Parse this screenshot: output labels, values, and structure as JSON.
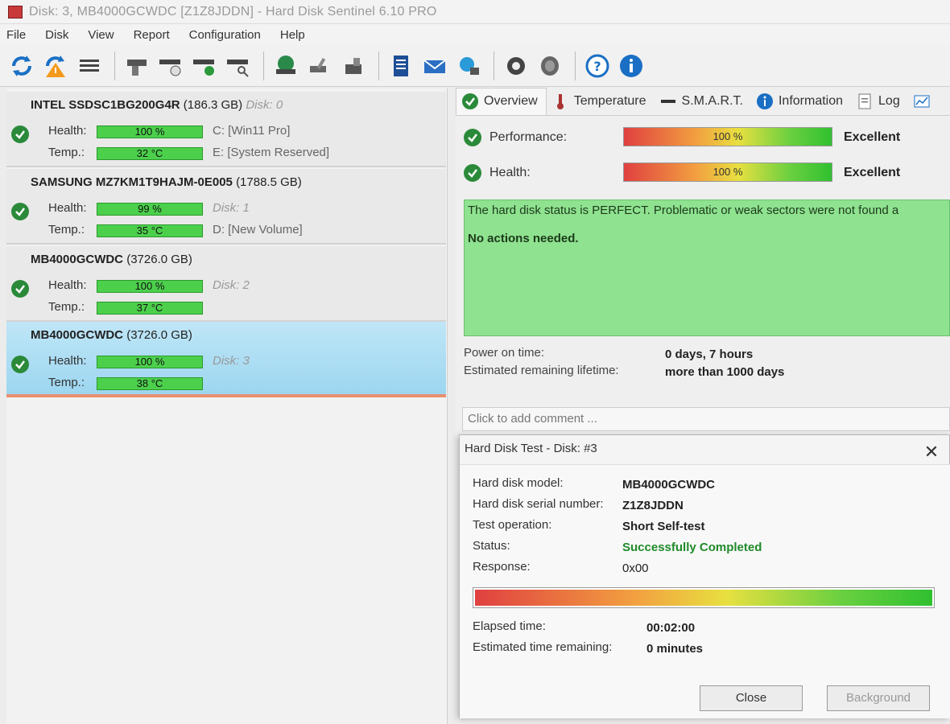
{
  "window": {
    "title": "Disk: 3, MB4000GCWDC [Z1Z8JDDN]  -  Hard Disk Sentinel 6.10 PRO"
  },
  "menu": [
    "File",
    "Disk",
    "View",
    "Report",
    "Configuration",
    "Help"
  ],
  "toolbar_icons": [
    "refresh-icon",
    "alert-refresh-icon",
    "disk-list-icon",
    "disk-info-icon",
    "disk-schedule-icon",
    "disk-check-icon",
    "disk-search-icon",
    "globe-disk-icon",
    "disk-tools-icon",
    "disk-lock-icon",
    "report-icon",
    "mail-icon",
    "network-icon",
    "settings-icon",
    "speaker-icon",
    "help-icon",
    "info-icon"
  ],
  "disks": [
    {
      "name": "INTEL SSDSC1BG200G4R",
      "capacity": "(186.3 GB)",
      "disk_no": "Disk: 0",
      "health_label": "Health:",
      "health": "100 %",
      "temp_label": "Temp.:",
      "temp": "32 °C",
      "side1": "C: [Win11 Pro]",
      "side2": "E:  [System Reserved]"
    },
    {
      "name": "SAMSUNG MZ7KM1T9HAJM-0E005",
      "capacity": "(1788.5 GB)",
      "disk_no": "",
      "health_label": "Health:",
      "health": "99 %",
      "temp_label": "Temp.:",
      "temp": "35 °C",
      "side1": "Disk: 1",
      "side2": "D: [New Volume]"
    },
    {
      "name": "MB4000GCWDC",
      "capacity": "(3726.0 GB)",
      "disk_no": "",
      "health_label": "Health:",
      "health": "100 %",
      "temp_label": "Temp.:",
      "temp": "37 °C",
      "side1": "Disk: 2",
      "side2": ""
    },
    {
      "name": "MB4000GCWDC",
      "capacity": "(3726.0 GB)",
      "disk_no": "",
      "health_label": "Health:",
      "health": "100 %",
      "temp_label": "Temp.:",
      "temp": "38 °C",
      "side1": "Disk: 3",
      "side2": ""
    }
  ],
  "tabs": [
    "Overview",
    "Temperature",
    "S.M.A.R.T.",
    "Information",
    "Log"
  ],
  "overview": {
    "performance_label": "Performance:",
    "performance_value": "100 %",
    "performance_rating": "Excellent",
    "performance_level": 1.0,
    "health_label": "Health:",
    "health_value": "100 %",
    "health_rating": "Excellent",
    "health_level": 1.0,
    "status_text": "The hard disk status is PERFECT. Problematic or weak sectors were not found a",
    "actions_text": "No actions needed.",
    "power_on_label": "Power on time:",
    "power_on_value": "0 days, 7 hours",
    "lifetime_label": "Estimated remaining lifetime:",
    "lifetime_value": "more than 1000 days",
    "comment_placeholder": "Click to add comment ..."
  },
  "dialog": {
    "title": "Hard Disk Test - Disk: #3",
    "model_label": "Hard disk model:",
    "model_value": "MB4000GCWDC",
    "serial_label": "Hard disk serial number:",
    "serial_value": "Z1Z8JDDN",
    "operation_label": "Test operation:",
    "operation_value": "Short Self-test",
    "status_label": "Status:",
    "status_value": "Successfully Completed",
    "response_label": "Response:",
    "response_value": "0x00",
    "progress": 1.0,
    "elapsed_label": "Elapsed time:",
    "elapsed_value": "00:02:00",
    "remaining_label": "Estimated time remaining:",
    "remaining_value": "0 minutes",
    "close_label": "Close",
    "background_label": "Background"
  }
}
